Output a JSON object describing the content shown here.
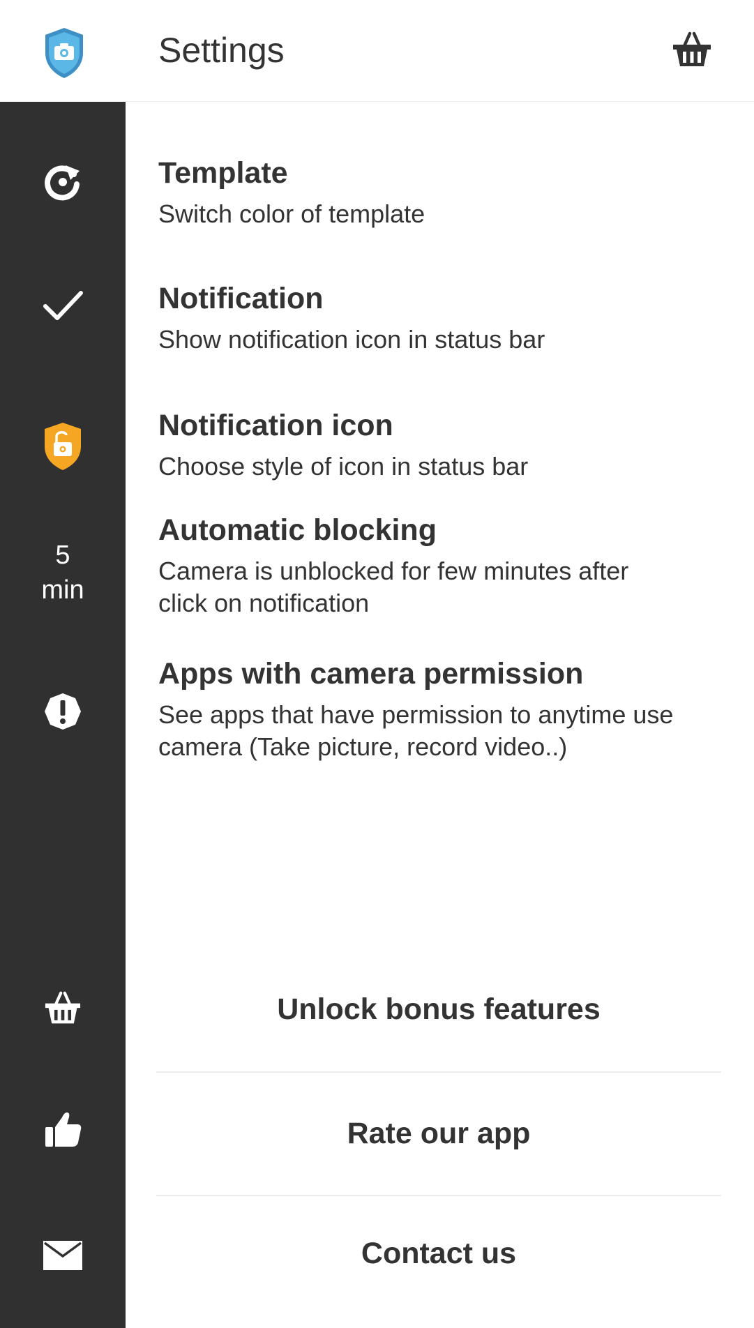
{
  "header": {
    "title": "Settings",
    "logo_icon": "shield-camera-icon",
    "basket_icon": "basket-icon"
  },
  "sidebar": {
    "items": [
      {
        "icon": "refresh-icon"
      },
      {
        "icon": "checkmark-icon"
      },
      {
        "icon": "unlock-shield-icon",
        "color": "#F5A623"
      },
      {
        "line1": "5",
        "line2": "min"
      },
      {
        "icon": "alert-icon"
      },
      {
        "icon": "basket-icon"
      },
      {
        "icon": "thumbs-up-icon"
      },
      {
        "icon": "mail-icon"
      }
    ]
  },
  "settings": [
    {
      "title": "Template",
      "desc": "Switch color of template"
    },
    {
      "title": "Notification",
      "desc": "Show notification icon in status bar"
    },
    {
      "title": "Notification icon",
      "desc": "Choose style of icon in status bar"
    },
    {
      "title": "Automatic blocking",
      "desc_line1": "Camera is unblocked for few minutes after",
      "desc_line2": "click on notification"
    },
    {
      "title": "Apps with camera permission",
      "desc_line1": "See apps that have permission to anytime use",
      "desc_line2": "camera (Take picture, record video..)"
    }
  ],
  "actions": {
    "unlock": "Unlock bonus features",
    "rate": "Rate our app",
    "contact": "Contact us"
  },
  "colors": {
    "sidebar_bg": "#303030",
    "accent_blue": "#4AA8D8",
    "accent_orange": "#F5A623"
  }
}
